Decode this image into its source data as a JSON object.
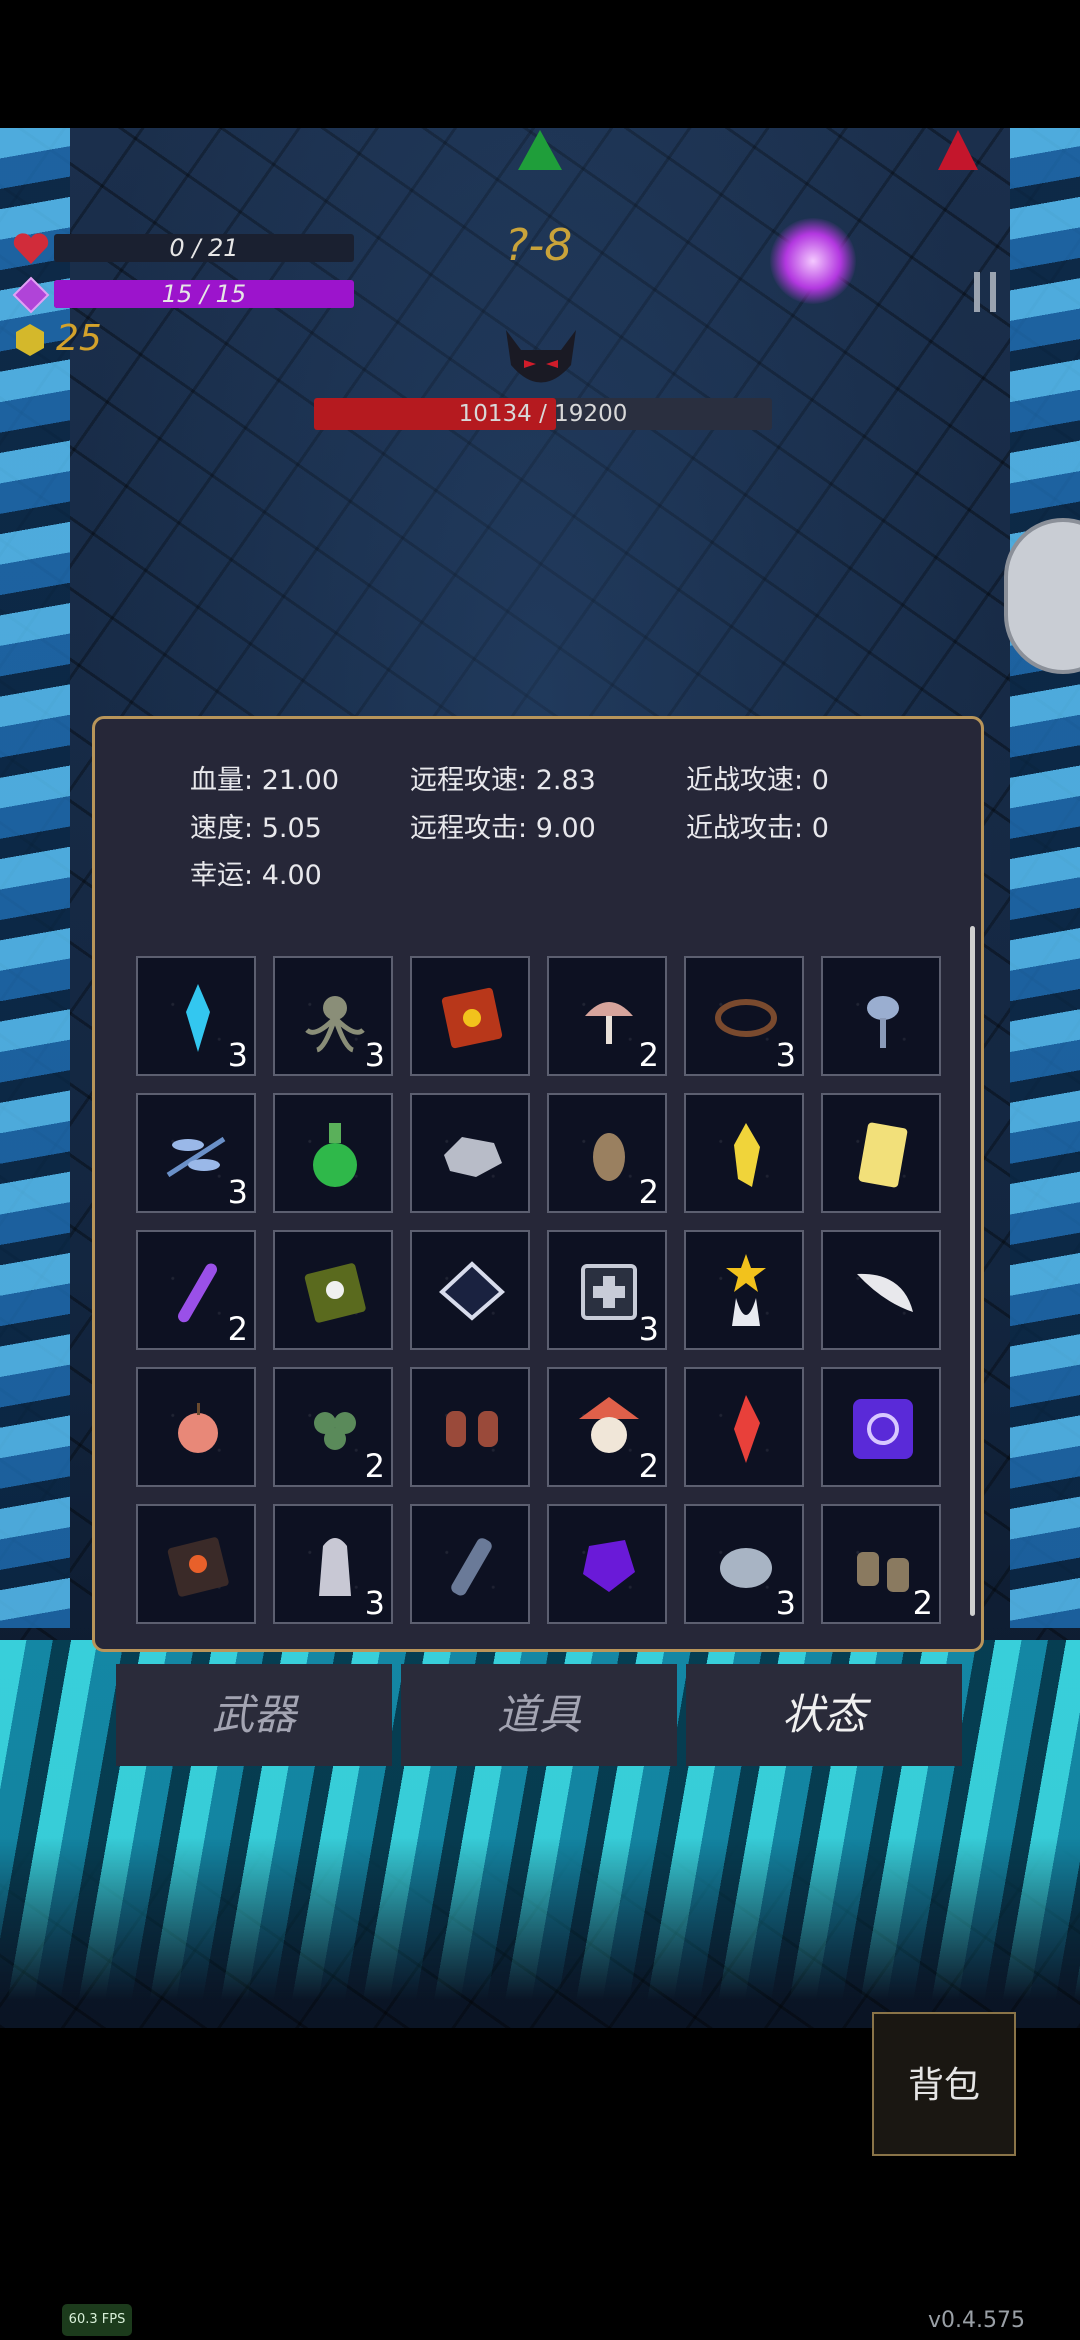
{
  "hud": {
    "hp_text": "0 / 21",
    "mp_text": "15 / 15",
    "coins": "25",
    "stage": "?-8",
    "boss_hp_text": "10134 / 19200",
    "boss_hp_fraction": 0.528,
    "hp_fraction": 0.0,
    "mp_fraction": 1.0,
    "colors": {
      "mp": "#9c14cc",
      "boss_hp": "#b51a1f",
      "gold": "#d4a22b"
    }
  },
  "stats": [
    {
      "label": "血量:",
      "value": "21.00"
    },
    {
      "label": "远程攻速:",
      "value": "2.83"
    },
    {
      "label": "近战攻速:",
      "value": "0"
    },
    {
      "label": "速度:",
      "value": "5.05"
    },
    {
      "label": "远程攻击:",
      "value": "9.00"
    },
    {
      "label": "近战攻击:",
      "value": "0"
    },
    {
      "label": "幸运:",
      "value": "4.00"
    }
  ],
  "items": [
    {
      "icon": "blue-crystal-icon",
      "count": "3"
    },
    {
      "icon": "tentacle-creature-icon",
      "count": "3"
    },
    {
      "icon": "red-book-icon",
      "count": ""
    },
    {
      "icon": "mushroom-icon",
      "count": "2"
    },
    {
      "icon": "thorn-crown-icon",
      "count": "3"
    },
    {
      "icon": "flower-icon",
      "count": ""
    },
    {
      "icon": "dragonfly-icon",
      "count": "3"
    },
    {
      "icon": "green-potion-icon",
      "count": ""
    },
    {
      "icon": "silver-ore-icon",
      "count": ""
    },
    {
      "icon": "seed-icon",
      "count": "2"
    },
    {
      "icon": "yellow-gem-icon",
      "count": ""
    },
    {
      "icon": "yellow-card-icon",
      "count": ""
    },
    {
      "icon": "purple-vial-icon",
      "count": "2"
    },
    {
      "icon": "skull-book-icon",
      "count": ""
    },
    {
      "icon": "diamond-plate-icon",
      "count": ""
    },
    {
      "icon": "medkit-icon",
      "count": "3"
    },
    {
      "icon": "star-trophy-icon",
      "count": ""
    },
    {
      "icon": "feather-icon",
      "count": ""
    },
    {
      "icon": "apple-icon",
      "count": ""
    },
    {
      "icon": "clover-icon",
      "count": "2"
    },
    {
      "icon": "gloves-icon",
      "count": ""
    },
    {
      "icon": "feather-mask-icon",
      "count": "2"
    },
    {
      "icon": "red-crystal-icon",
      "count": ""
    },
    {
      "icon": "rune-icon",
      "count": ""
    },
    {
      "icon": "demon-book-icon",
      "count": ""
    },
    {
      "icon": "ghost-cloak-icon",
      "count": "3"
    },
    {
      "icon": "bottle-icon",
      "count": ""
    },
    {
      "icon": "purple-shell-icon",
      "count": ""
    },
    {
      "icon": "stone-icon",
      "count": "3"
    },
    {
      "icon": "boots-icon",
      "count": "2"
    }
  ],
  "tabs": [
    {
      "label": "武器",
      "active": false
    },
    {
      "label": "道具",
      "active": false
    },
    {
      "label": "状态",
      "active": true
    }
  ],
  "bag_button": "背包",
  "fps": "60.3 FPS",
  "version": "v0.4.575"
}
